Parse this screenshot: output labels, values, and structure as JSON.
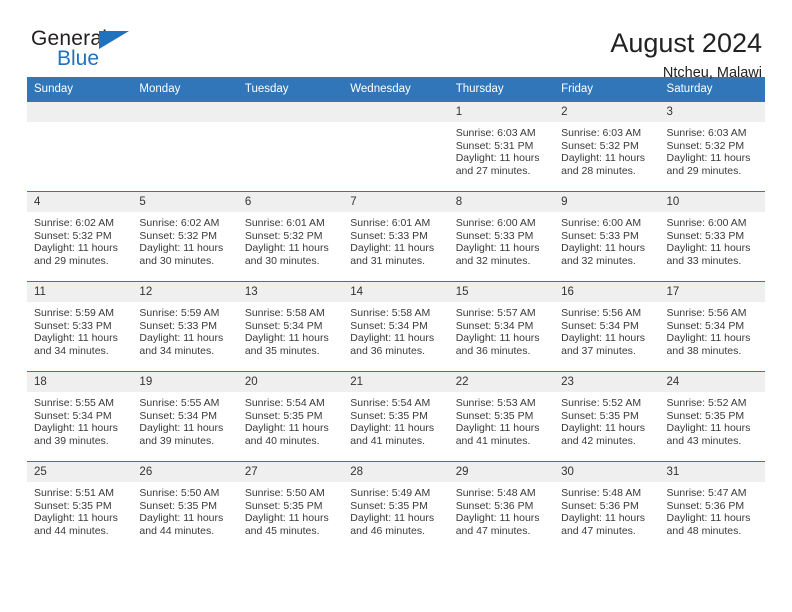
{
  "brand": {
    "name_part1": "General",
    "name_part2": "Blue",
    "logo_icon": "triangle-icon",
    "colors": {
      "blue": "#1f72bd",
      "dark": "#231f20"
    }
  },
  "header": {
    "title": "August 2024",
    "subtitle": "Ntcheu, Malawi",
    "header_bg": "#3176b9",
    "daynum_bg": "#efefef"
  },
  "weekday_headers": [
    "Sunday",
    "Monday",
    "Tuesday",
    "Wednesday",
    "Thursday",
    "Friday",
    "Saturday"
  ],
  "labels": {
    "sunrise": "Sunrise:",
    "sunset": "Sunset:",
    "daylight": "Daylight:"
  },
  "weeks": [
    [
      {
        "day": "",
        "empty": true
      },
      {
        "day": "",
        "empty": true
      },
      {
        "day": "",
        "empty": true
      },
      {
        "day": "",
        "empty": true
      },
      {
        "day": "1",
        "sunrise": "Sunrise: 6:03 AM",
        "sunset": "Sunset: 5:31 PM",
        "daylight_l1": "Daylight: 11 hours",
        "daylight_l2": "and 27 minutes."
      },
      {
        "day": "2",
        "sunrise": "Sunrise: 6:03 AM",
        "sunset": "Sunset: 5:32 PM",
        "daylight_l1": "Daylight: 11 hours",
        "daylight_l2": "and 28 minutes."
      },
      {
        "day": "3",
        "sunrise": "Sunrise: 6:03 AM",
        "sunset": "Sunset: 5:32 PM",
        "daylight_l1": "Daylight: 11 hours",
        "daylight_l2": "and 29 minutes."
      }
    ],
    [
      {
        "day": "4",
        "sunrise": "Sunrise: 6:02 AM",
        "sunset": "Sunset: 5:32 PM",
        "daylight_l1": "Daylight: 11 hours",
        "daylight_l2": "and 29 minutes."
      },
      {
        "day": "5",
        "sunrise": "Sunrise: 6:02 AM",
        "sunset": "Sunset: 5:32 PM",
        "daylight_l1": "Daylight: 11 hours",
        "daylight_l2": "and 30 minutes."
      },
      {
        "day": "6",
        "sunrise": "Sunrise: 6:01 AM",
        "sunset": "Sunset: 5:32 PM",
        "daylight_l1": "Daylight: 11 hours",
        "daylight_l2": "and 30 minutes."
      },
      {
        "day": "7",
        "sunrise": "Sunrise: 6:01 AM",
        "sunset": "Sunset: 5:33 PM",
        "daylight_l1": "Daylight: 11 hours",
        "daylight_l2": "and 31 minutes."
      },
      {
        "day": "8",
        "sunrise": "Sunrise: 6:00 AM",
        "sunset": "Sunset: 5:33 PM",
        "daylight_l1": "Daylight: 11 hours",
        "daylight_l2": "and 32 minutes."
      },
      {
        "day": "9",
        "sunrise": "Sunrise: 6:00 AM",
        "sunset": "Sunset: 5:33 PM",
        "daylight_l1": "Daylight: 11 hours",
        "daylight_l2": "and 32 minutes."
      },
      {
        "day": "10",
        "sunrise": "Sunrise: 6:00 AM",
        "sunset": "Sunset: 5:33 PM",
        "daylight_l1": "Daylight: 11 hours",
        "daylight_l2": "and 33 minutes."
      }
    ],
    [
      {
        "day": "11",
        "sunrise": "Sunrise: 5:59 AM",
        "sunset": "Sunset: 5:33 PM",
        "daylight_l1": "Daylight: 11 hours",
        "daylight_l2": "and 34 minutes."
      },
      {
        "day": "12",
        "sunrise": "Sunrise: 5:59 AM",
        "sunset": "Sunset: 5:33 PM",
        "daylight_l1": "Daylight: 11 hours",
        "daylight_l2": "and 34 minutes."
      },
      {
        "day": "13",
        "sunrise": "Sunrise: 5:58 AM",
        "sunset": "Sunset: 5:34 PM",
        "daylight_l1": "Daylight: 11 hours",
        "daylight_l2": "and 35 minutes."
      },
      {
        "day": "14",
        "sunrise": "Sunrise: 5:58 AM",
        "sunset": "Sunset: 5:34 PM",
        "daylight_l1": "Daylight: 11 hours",
        "daylight_l2": "and 36 minutes."
      },
      {
        "day": "15",
        "sunrise": "Sunrise: 5:57 AM",
        "sunset": "Sunset: 5:34 PM",
        "daylight_l1": "Daylight: 11 hours",
        "daylight_l2": "and 36 minutes."
      },
      {
        "day": "16",
        "sunrise": "Sunrise: 5:56 AM",
        "sunset": "Sunset: 5:34 PM",
        "daylight_l1": "Daylight: 11 hours",
        "daylight_l2": "and 37 minutes."
      },
      {
        "day": "17",
        "sunrise": "Sunrise: 5:56 AM",
        "sunset": "Sunset: 5:34 PM",
        "daylight_l1": "Daylight: 11 hours",
        "daylight_l2": "and 38 minutes."
      }
    ],
    [
      {
        "day": "18",
        "sunrise": "Sunrise: 5:55 AM",
        "sunset": "Sunset: 5:34 PM",
        "daylight_l1": "Daylight: 11 hours",
        "daylight_l2": "and 39 minutes."
      },
      {
        "day": "19",
        "sunrise": "Sunrise: 5:55 AM",
        "sunset": "Sunset: 5:34 PM",
        "daylight_l1": "Daylight: 11 hours",
        "daylight_l2": "and 39 minutes."
      },
      {
        "day": "20",
        "sunrise": "Sunrise: 5:54 AM",
        "sunset": "Sunset: 5:35 PM",
        "daylight_l1": "Daylight: 11 hours",
        "daylight_l2": "and 40 minutes."
      },
      {
        "day": "21",
        "sunrise": "Sunrise: 5:54 AM",
        "sunset": "Sunset: 5:35 PM",
        "daylight_l1": "Daylight: 11 hours",
        "daylight_l2": "and 41 minutes."
      },
      {
        "day": "22",
        "sunrise": "Sunrise: 5:53 AM",
        "sunset": "Sunset: 5:35 PM",
        "daylight_l1": "Daylight: 11 hours",
        "daylight_l2": "and 41 minutes."
      },
      {
        "day": "23",
        "sunrise": "Sunrise: 5:52 AM",
        "sunset": "Sunset: 5:35 PM",
        "daylight_l1": "Daylight: 11 hours",
        "daylight_l2": "and 42 minutes."
      },
      {
        "day": "24",
        "sunrise": "Sunrise: 5:52 AM",
        "sunset": "Sunset: 5:35 PM",
        "daylight_l1": "Daylight: 11 hours",
        "daylight_l2": "and 43 minutes."
      }
    ],
    [
      {
        "day": "25",
        "sunrise": "Sunrise: 5:51 AM",
        "sunset": "Sunset: 5:35 PM",
        "daylight_l1": "Daylight: 11 hours",
        "daylight_l2": "and 44 minutes."
      },
      {
        "day": "26",
        "sunrise": "Sunrise: 5:50 AM",
        "sunset": "Sunset: 5:35 PM",
        "daylight_l1": "Daylight: 11 hours",
        "daylight_l2": "and 44 minutes."
      },
      {
        "day": "27",
        "sunrise": "Sunrise: 5:50 AM",
        "sunset": "Sunset: 5:35 PM",
        "daylight_l1": "Daylight: 11 hours",
        "daylight_l2": "and 45 minutes."
      },
      {
        "day": "28",
        "sunrise": "Sunrise: 5:49 AM",
        "sunset": "Sunset: 5:35 PM",
        "daylight_l1": "Daylight: 11 hours",
        "daylight_l2": "and 46 minutes."
      },
      {
        "day": "29",
        "sunrise": "Sunrise: 5:48 AM",
        "sunset": "Sunset: 5:36 PM",
        "daylight_l1": "Daylight: 11 hours",
        "daylight_l2": "and 47 minutes."
      },
      {
        "day": "30",
        "sunrise": "Sunrise: 5:48 AM",
        "sunset": "Sunset: 5:36 PM",
        "daylight_l1": "Daylight: 11 hours",
        "daylight_l2": "and 47 minutes."
      },
      {
        "day": "31",
        "sunrise": "Sunrise: 5:47 AM",
        "sunset": "Sunset: 5:36 PM",
        "daylight_l1": "Daylight: 11 hours",
        "daylight_l2": "and 48 minutes."
      }
    ]
  ]
}
